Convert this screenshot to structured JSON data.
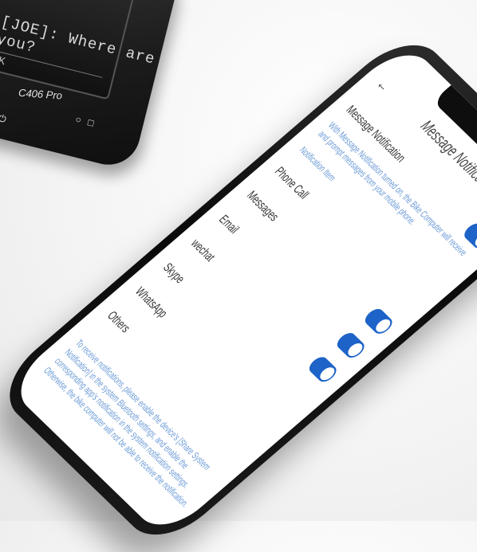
{
  "bike_computer": {
    "message_line_1": "[JOE]: Where are",
    "message_line_2": "you?",
    "ok_label": "OK",
    "model": "C406 Pro"
  },
  "app": {
    "title": "Message Notification",
    "message_notification_label": "Message Notification",
    "description": "With Message Notification turned on, the Bike Computer will receive and prompt messages from your mobile phone.",
    "section_label": "Notification Item",
    "items": [
      {
        "label": "Phone Call"
      },
      {
        "label": "Messages"
      },
      {
        "label": "Email"
      },
      {
        "label": "wechat"
      },
      {
        "label": "Skype"
      },
      {
        "label": "WhatsApp"
      },
      {
        "label": "Others"
      }
    ],
    "footer_note": "To receive notifications, please enable the device's [Share System Notification] in the system Bluetooth settings, and enable the corresponding app's notification in the system notification settings. Otherwise, the bike computer will not be able to receive the notification."
  },
  "colors": {
    "toggle_on": "#1d63c8",
    "hint_text": "#6a9ad6"
  }
}
